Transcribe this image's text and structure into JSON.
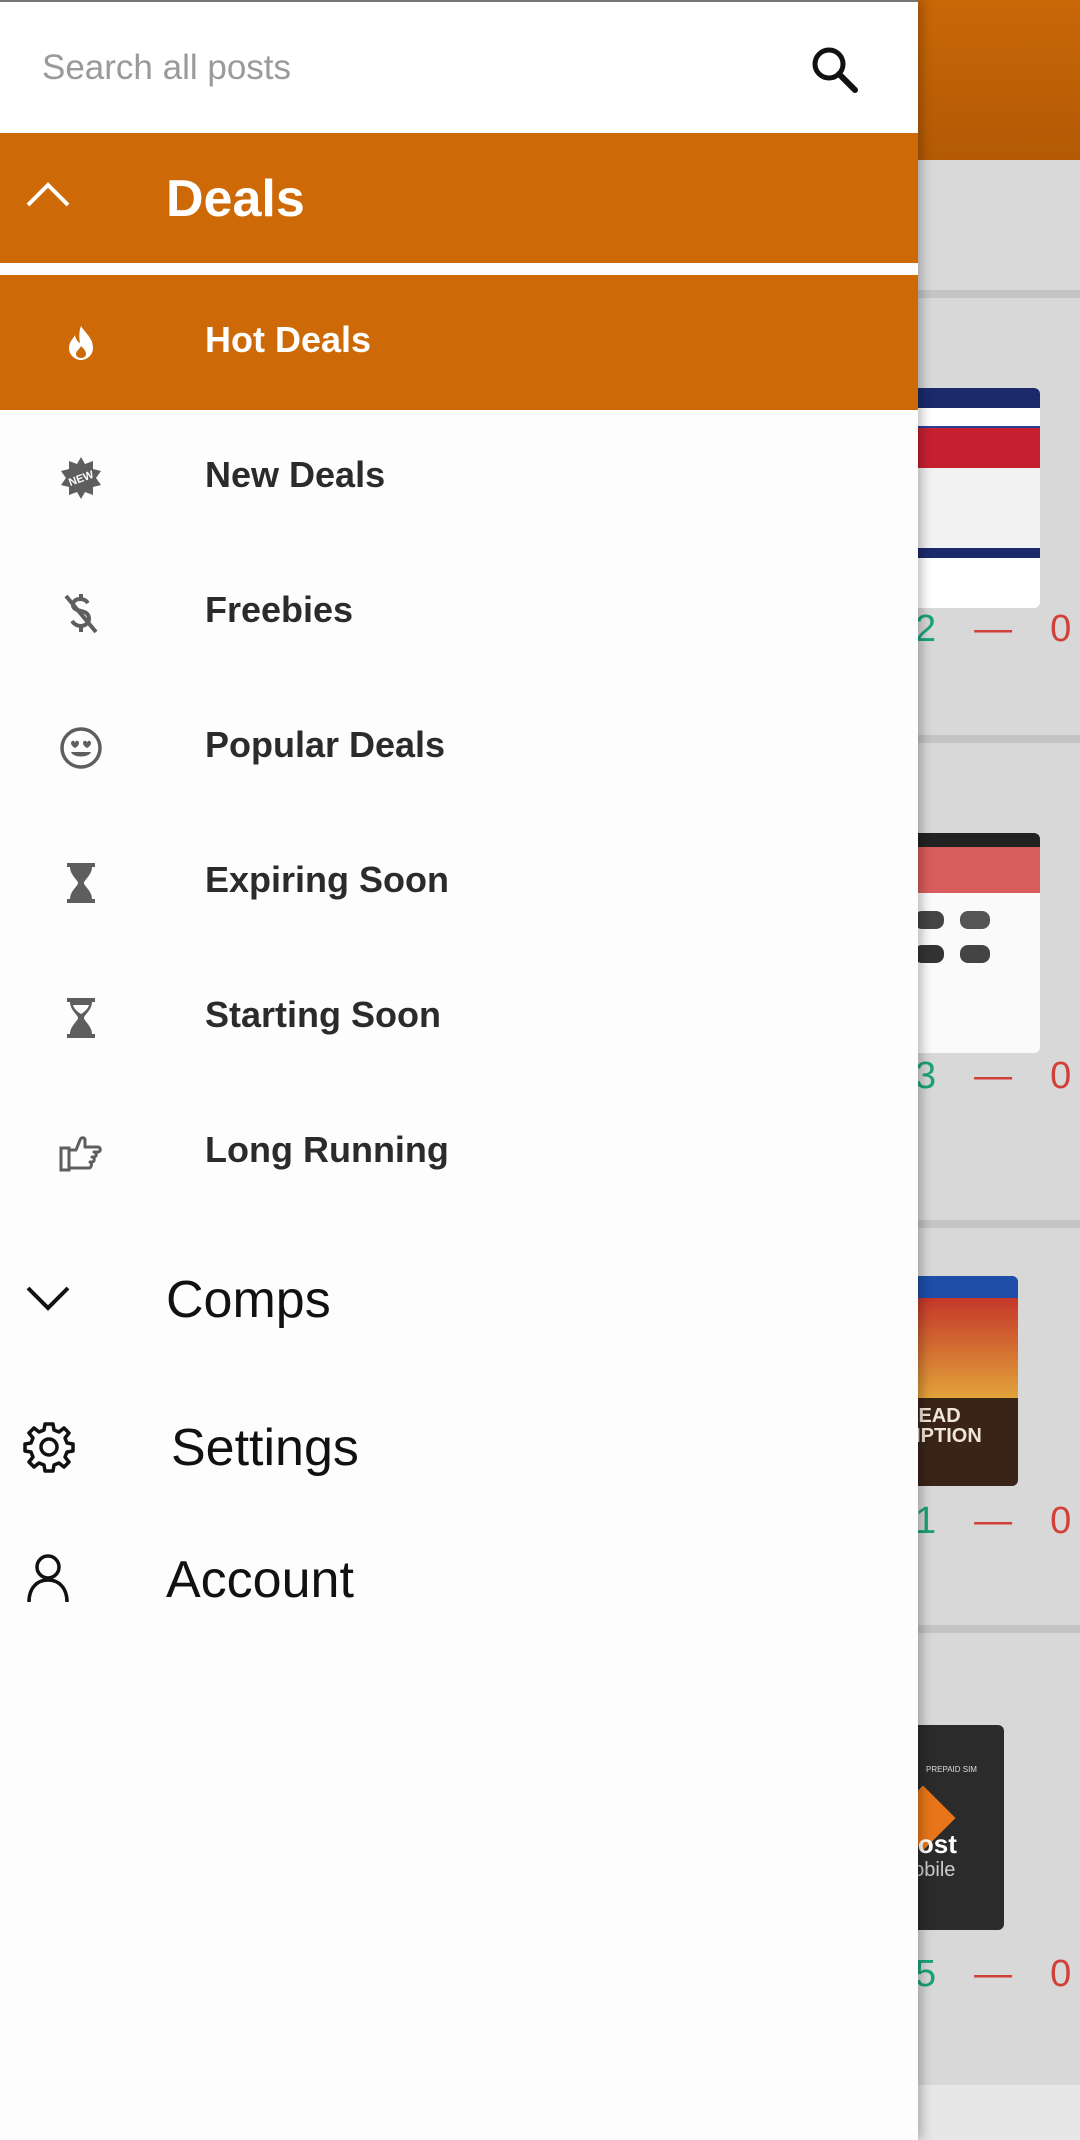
{
  "search": {
    "placeholder": "Search all posts",
    "icon": "search-icon"
  },
  "deals_section": {
    "label": "Deals",
    "expanded": true,
    "items": [
      {
        "label": "Hot Deals",
        "icon": "flame-icon",
        "active": true
      },
      {
        "label": "New Deals",
        "icon": "new-badge-icon",
        "active": false
      },
      {
        "label": "Freebies",
        "icon": "no-dollar-icon",
        "active": false
      },
      {
        "label": "Popular Deals",
        "icon": "smiley-heart-eyes-icon",
        "active": false
      },
      {
        "label": "Expiring Soon",
        "icon": "hourglass-icon",
        "active": false
      },
      {
        "label": "Starting Soon",
        "icon": "hourglass-icon",
        "active": false
      },
      {
        "label": "Long Running",
        "icon": "thumbs-up-icon",
        "active": false
      }
    ]
  },
  "comps_section": {
    "label": "Comps",
    "expanded": false
  },
  "settings": {
    "label": "Settings",
    "icon": "gear-icon"
  },
  "account": {
    "label": "Account",
    "icon": "user-icon"
  },
  "background_feed": {
    "votes": [
      {
        "up": "2",
        "sep": "—",
        "down": "0"
      },
      {
        "up": "3",
        "sep": "—",
        "down": "0"
      },
      {
        "up": "1",
        "sep": "—",
        "down": "0"
      },
      {
        "up": "5",
        "sep": "—",
        "down": "0"
      }
    ],
    "thumb_texts": [
      "DEAD",
      "MPTION",
      "oost",
      "nobile",
      "PREPAID SIM"
    ]
  },
  "colors": {
    "accent": "#cd6a07",
    "vote_up": "#1aa37b",
    "vote_down": "#d2403a"
  }
}
